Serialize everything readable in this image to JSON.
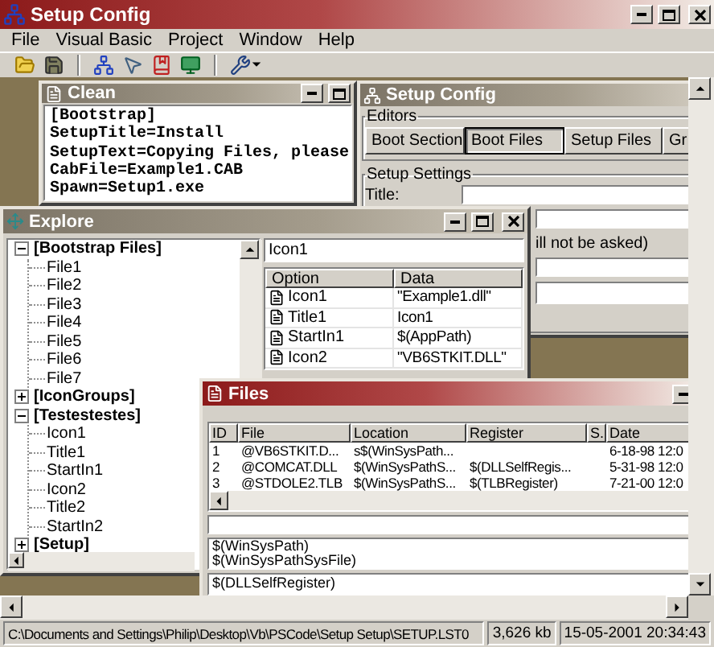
{
  "window": {
    "title": "Setup Config",
    "active": true
  },
  "menu": [
    "File",
    "Visual Basic",
    "Project",
    "Window",
    "Help"
  ],
  "clean_window": {
    "title": "Clean",
    "active": false,
    "lines": [
      "[Bootstrap]",
      "SetupTitle=Install",
      "SetupText=Copying Files, please",
      "CabFile=Example1.CAB",
      "Spawn=Setup1.exe"
    ]
  },
  "setup_window": {
    "title": "Setup Config",
    "active": false,
    "editors": {
      "label": "Editors",
      "buttons": [
        {
          "label": "Boot Section",
          "selected": false
        },
        {
          "label": "Boot Files",
          "selected": true
        },
        {
          "label": "Setup Files",
          "selected": false
        },
        {
          "label": "Gr",
          "selected": false
        }
      ]
    },
    "settings": {
      "label": "Setup Settings",
      "title_label": "Title:",
      "note": "ill not be asked)"
    }
  },
  "explore_window": {
    "title": "Explore",
    "active": false,
    "tree": [
      {
        "label": "[Bootstrap Files]",
        "expanded": true,
        "children": [
          {
            "label": "File1"
          },
          {
            "label": "File2"
          },
          {
            "label": "File3"
          },
          {
            "label": "File4"
          },
          {
            "label": "File5"
          },
          {
            "label": "File6"
          },
          {
            "label": "File7"
          }
        ]
      },
      {
        "label": "[IconGroups]",
        "expanded": false
      },
      {
        "label": "[Testestestes]",
        "expanded": true,
        "children": [
          {
            "label": "Icon1"
          },
          {
            "label": "Title1"
          },
          {
            "label": "StartIn1"
          },
          {
            "label": "Icon2"
          },
          {
            "label": "Title2"
          },
          {
            "label": "StartIn2"
          }
        ]
      },
      {
        "label": "[Setup]",
        "expanded": false
      }
    ],
    "search": {
      "value": "Icon1"
    },
    "table": {
      "columns": [
        "Option",
        "Data"
      ],
      "rows": [
        {
          "option": "Icon1",
          "data": "\"Example1.dll\""
        },
        {
          "option": "Title1",
          "data": "Icon1"
        },
        {
          "option": "StartIn1",
          "data": "$(AppPath)"
        },
        {
          "option": "Icon2",
          "data": "\"VB6STKIT.DLL\""
        }
      ]
    }
  },
  "files_window": {
    "title": "Files",
    "active": true,
    "table": {
      "columns": [
        "ID",
        "File",
        "Location",
        "Register",
        "S.",
        "Date"
      ],
      "rows": [
        {
          "id": "1",
          "file": "@VB6STKIT.D...",
          "location": "s$(WinSysPath...",
          "date": "6-18-98 12:0"
        },
        {
          "id": "2",
          "file": "@COMCAT.DLL",
          "location": "$(WinSysPathS...",
          "register": "$(DLLSelfRegis...",
          "date": "5-31-98 12:0"
        },
        {
          "id": "3",
          "file": "@STDOLE2.TLB",
          "location": "$(WinSysPathS...",
          "register": "$(TLBRegister)",
          "date": "7-21-00 12:0"
        }
      ]
    },
    "paths": [
      "$(WinSysPath)",
      "$(WinSysPathSysFile)"
    ],
    "register": "$(DLLSelfRegister)"
  },
  "status_bar": {
    "path": "C:\\Documents and Settings\\Philip\\Desktop\\Vb\\PSCode\\Setup Setup\\SETUP.LST0",
    "size": "3,626 kb",
    "timestamp": "15-05-2001 20:34:43"
  }
}
